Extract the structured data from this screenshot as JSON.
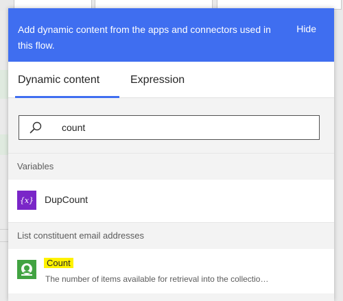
{
  "banner": {
    "message": "Add dynamic content from the apps and connectors used in this flow.",
    "hide_label": "Hide"
  },
  "tabs": [
    {
      "label": "Dynamic content",
      "active": true
    },
    {
      "label": "Expression",
      "active": false
    }
  ],
  "search": {
    "value": "count"
  },
  "sections": [
    {
      "header": "Variables",
      "items": [
        {
          "title": "DupCount",
          "icon": "variable-icon",
          "description": ""
        }
      ]
    },
    {
      "header": "List constituent email addresses",
      "items": [
        {
          "title": "Count",
          "icon": "connector-icon",
          "description": "The number of items available for retrieval into the collectio…",
          "highlighted": true
        }
      ]
    }
  ],
  "colors": {
    "accent": "#3f6ef0",
    "variable_tile": "#7a26c8",
    "connector_tile": "#41a341",
    "highlight": "#fff200"
  }
}
